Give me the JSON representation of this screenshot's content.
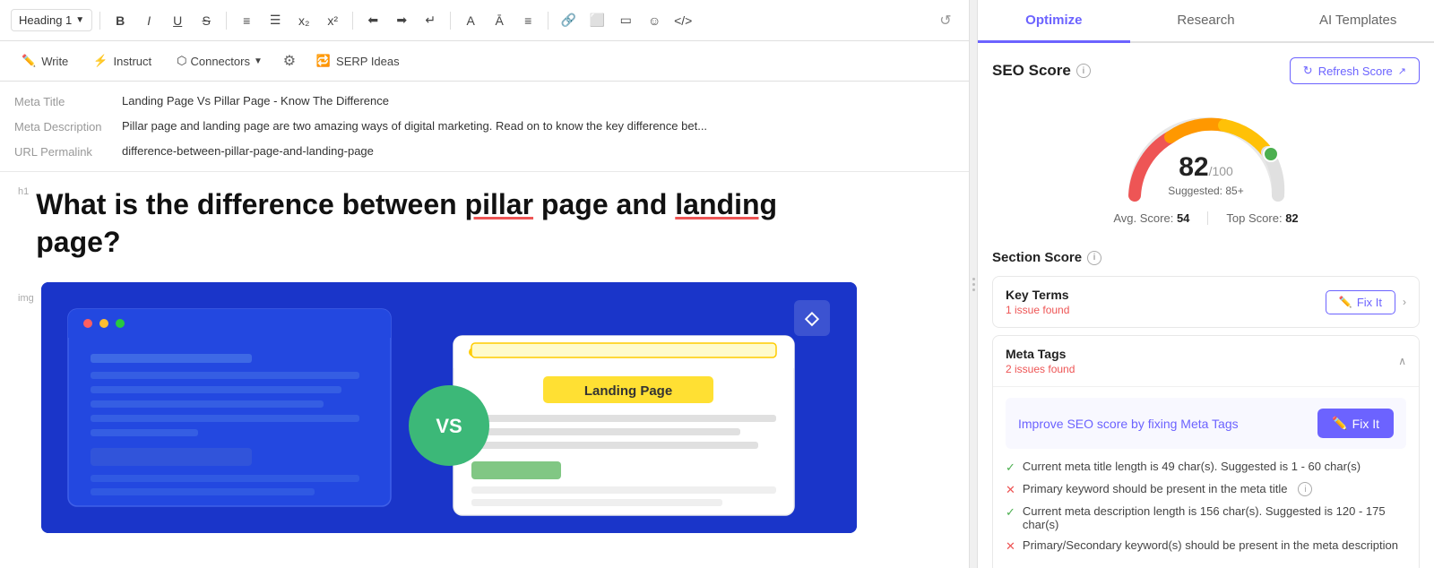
{
  "toolbar": {
    "heading_select": "Heading 1",
    "history_icon": "↺"
  },
  "secondary_toolbar": {
    "write_label": "Write",
    "instruct_label": "Instruct",
    "connectors_label": "Connectors",
    "serp_ideas_label": "SERP Ideas"
  },
  "meta": {
    "title_label": "Meta Title",
    "title_value": "Landing Page Vs Pillar Page - Know The Difference",
    "description_label": "Meta Description",
    "description_value": "Pillar page and landing page are two amazing ways of digital marketing. Read on to know the key difference bet...",
    "permalink_label": "URL Permalink",
    "permalink_value": "difference-between-pillar-page-and-landing-page"
  },
  "content": {
    "h1_label": "h1",
    "img_label": "img",
    "heading_line1": "What is the difference between pillar page and landing",
    "heading_line2": "page?",
    "heading_underline_words": [
      "pillar",
      "landing"
    ],
    "image_alt": "VS comparison illustration between pillar page and landing page"
  },
  "seo_panel": {
    "tabs": [
      {
        "label": "Optimize",
        "active": true
      },
      {
        "label": "Research",
        "active": false
      },
      {
        "label": "AI Templates",
        "active": false
      }
    ],
    "seo_score_title": "SEO Score",
    "refresh_btn": "Refresh Score",
    "score": 82,
    "score_max": 100,
    "suggested": "Suggested: 85+",
    "avg_score_label": "Avg. Score:",
    "avg_score_value": "54",
    "top_score_label": "Top Score:",
    "top_score_value": "82",
    "section_score_title": "Section Score",
    "items": [
      {
        "name": "Key Terms",
        "issues": "1 issue found",
        "fix_it_label": "Fix It",
        "expanded": false
      },
      {
        "name": "Meta Tags",
        "issues": "2 issues found",
        "fix_it_label": "Fix It",
        "expanded": true,
        "improve_text": "Improve SEO score by fixing Meta Tags",
        "checks": [
          {
            "pass": true,
            "text": "Current meta title length is 49 char(s). Suggested is 1 - 60 char(s)"
          },
          {
            "pass": false,
            "text": "Primary keyword should be present in the meta title",
            "has_info": true
          },
          {
            "pass": true,
            "text": "Current meta description length is 156 char(s). Suggested is 120 - 175 char(s)"
          },
          {
            "pass": false,
            "text": "Primary/Secondary keyword(s) should be present in the meta description"
          }
        ]
      }
    ]
  }
}
